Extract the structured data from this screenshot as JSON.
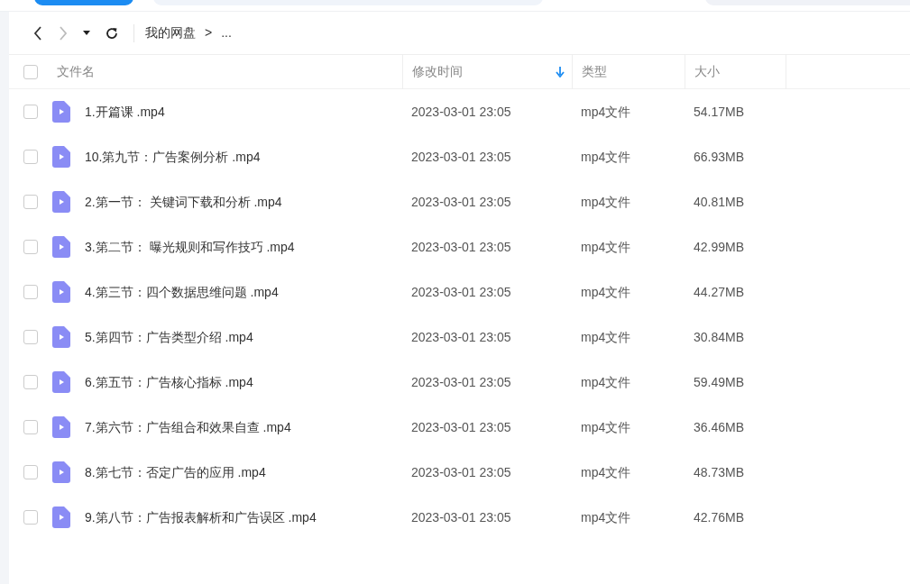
{
  "breadcrumb": [
    {
      "label": "我的网盘"
    },
    {
      "label": ">"
    },
    {
      "label": "..."
    }
  ],
  "header": {
    "checked": false,
    "columns": [
      {
        "label": "文件名",
        "sorted": false
      },
      {
        "label": "修改时间",
        "sorted": true
      },
      {
        "label": "类型",
        "sorted": false
      },
      {
        "label": "大小",
        "sorted": false
      }
    ]
  },
  "rows": [
    {
      "name": "1.开篇课 .mp4",
      "modified": "2023-03-01 23:05",
      "type": "mp4文件",
      "size": "54.17MB",
      "checked": false
    },
    {
      "name": "10.第九节：广告案例分析 .mp4",
      "modified": "2023-03-01 23:05",
      "type": "mp4文件",
      "size": "66.93MB",
      "checked": false
    },
    {
      "name": "2.第一节： 关键词下载和分析 .mp4",
      "modified": "2023-03-01 23:05",
      "type": "mp4文件",
      "size": "40.81MB",
      "checked": false
    },
    {
      "name": "3.第二节： 曝光规则和写作技巧 .mp4",
      "modified": "2023-03-01 23:05",
      "type": "mp4文件",
      "size": "42.99MB",
      "checked": false
    },
    {
      "name": "4.第三节：四个数据思维问题 .mp4",
      "modified": "2023-03-01 23:05",
      "type": "mp4文件",
      "size": "44.27MB",
      "checked": false
    },
    {
      "name": "5.第四节：广告类型介绍 .mp4",
      "modified": "2023-03-01 23:05",
      "type": "mp4文件",
      "size": "30.84MB",
      "checked": false
    },
    {
      "name": "6.第五节：广告核心指标 .mp4",
      "modified": "2023-03-01 23:05",
      "type": "mp4文件",
      "size": "59.49MB",
      "checked": false
    },
    {
      "name": "7.第六节：广告组合和效果自查 .mp4",
      "modified": "2023-03-01 23:05",
      "type": "mp4文件",
      "size": "36.46MB",
      "checked": false
    },
    {
      "name": "8.第七节：否定广告的应用 .mp4",
      "modified": "2023-03-01 23:05",
      "type": "mp4文件",
      "size": "48.73MB",
      "checked": false
    },
    {
      "name": "9.第八节：广告报表解析和广告误区 .mp4",
      "modified": "2023-03-01 23:05",
      "type": "mp4文件",
      "size": "42.76MB",
      "checked": false
    }
  ]
}
